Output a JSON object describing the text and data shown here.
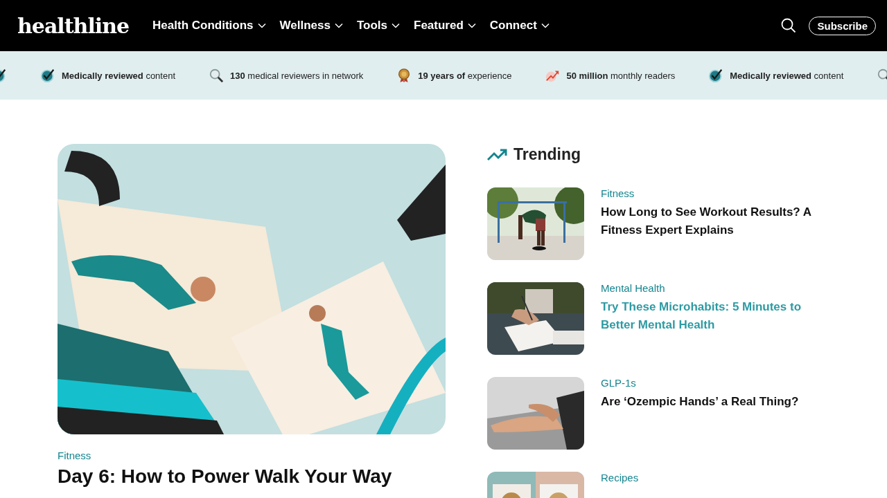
{
  "header": {
    "logo": "healthline",
    "nav": [
      {
        "label": "Health Conditions"
      },
      {
        "label": "Wellness"
      },
      {
        "label": "Tools"
      },
      {
        "label": "Featured"
      },
      {
        "label": "Connect"
      }
    ],
    "subscribe": "Subscribe"
  },
  "trust_strip": [
    {
      "kind": "check"
    },
    {
      "kind": "check",
      "text": "**Medically reviewed** content"
    },
    {
      "kind": "search",
      "text": "**130** medical reviewers in network"
    },
    {
      "kind": "medal",
      "text": "**19 years of** experience"
    },
    {
      "kind": "chart",
      "text": "**50 million** monthly readers"
    },
    {
      "kind": "check",
      "text": "**Medically reviewed** content"
    },
    {
      "kind": "search"
    }
  ],
  "hero": {
    "kind": "picture",
    "category": "Fitness",
    "title": "Day 6: How to Power Walk Your Way"
  },
  "trending": {
    "title": "Trending",
    "items": [
      {
        "category": "Fitness",
        "title": "How Long to See Workout Results? A Fitness Expert Explains",
        "highlighted": false
      },
      {
        "category": "Mental Health",
        "title": "Try These Microhabits: 5 Minutes to Better Mental Health",
        "highlighted": true
      },
      {
        "category": "GLP-1s",
        "title": "Are ‘Ozempic Hands’ a Real Thing?",
        "highlighted": false
      },
      {
        "category": "Recipes"
      }
    ]
  }
}
